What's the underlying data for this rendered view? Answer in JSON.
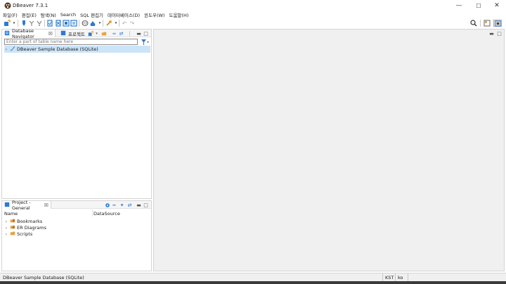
{
  "window": {
    "title": "DBeaver 7.3.1",
    "minimize_glyph": "—",
    "maximize_glyph": "☐",
    "close_glyph": "✕"
  },
  "menu": [
    "파일(F)",
    "편집(E)",
    "탐색(N)",
    "Search",
    "SQL 편집기",
    "데이터베이스(D)",
    "윈도우(W)",
    "도움말(H)"
  ],
  "toolbar": {
    "icons": [
      "new-connection-icon",
      "dropdown-arrow-icon",
      "connect-icon",
      "disconnect-icon",
      "invalidate-icon",
      "transaction-commit-icon",
      "transaction-rollback-icon",
      "transaction-mode-icon",
      "transaction-log-icon",
      "sql-editor-icon",
      "open-sql-icon",
      "dropdown-arrow-icon",
      "tools-icon",
      "dropdown-arrow-icon",
      "back-icon",
      "forward-icon"
    ],
    "right_icons": [
      "search-icon",
      "perspective-icon",
      "dbeaver-perspective-icon"
    ]
  },
  "navigator": {
    "tab_label": "Database Navigator",
    "second_tab_label": "프로젝트",
    "filter_placeholder": "Enter a part of table name here",
    "items": [
      {
        "label": "DBeaver Sample Database (SQLite)",
        "selected": true
      }
    ]
  },
  "project": {
    "tab_label": "Project - General",
    "columns": [
      "Name",
      "DataSource"
    ],
    "items": [
      {
        "label": "Bookmarks"
      },
      {
        "label": "ER Diagrams"
      },
      {
        "label": "Scripts"
      }
    ]
  },
  "status": {
    "text": "DBeaver Sample Database (SQLite)",
    "timezone": "KST",
    "locale": "ko"
  },
  "colors": {
    "selection": "#cce4f7",
    "folder": "#e8a33c",
    "accent_blue": "#2a7bd1"
  }
}
